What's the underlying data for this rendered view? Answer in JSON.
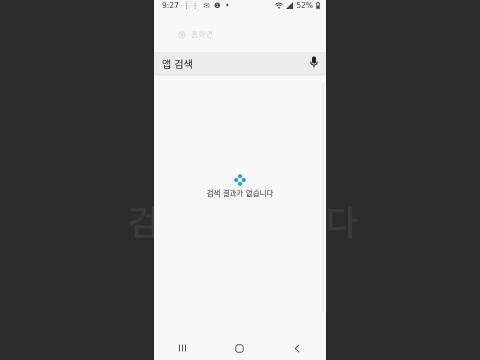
{
  "background": {
    "left_fragment": "검",
    "right_fragment": "다"
  },
  "status_bar": {
    "time": "9:27",
    "left_icons_text": "⋮⋮ ✉ ❶ •",
    "battery": "52%"
  },
  "faint_row": {
    "label": "홈화면"
  },
  "search": {
    "label": "앱 검색"
  },
  "empty_state": {
    "message": "검색 결과가 없습니다"
  },
  "colors": {
    "phone_bg": "#f8f8f8",
    "search_bg": "#ececec",
    "accent_icon": "#2a9fd6"
  },
  "icons": {
    "mic": "mic-icon",
    "empty_state": "diamond-dots-icon",
    "nav_recent": "recent-apps-icon",
    "nav_home": "home-icon",
    "nav_back": "back-icon"
  }
}
